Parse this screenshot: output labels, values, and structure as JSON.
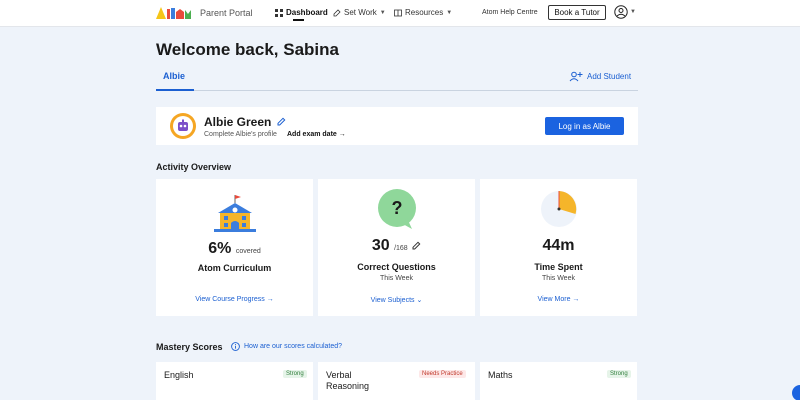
{
  "nav": {
    "portal_label": "Parent Portal",
    "dashboard": "Dashboard",
    "set_work": "Set Work",
    "resources": "Resources",
    "help": "Atom Help Centre",
    "book_tutor": "Book a Tutor"
  },
  "header": {
    "welcome": "Welcome back, Sabina",
    "tab": "Albie",
    "add_student": "Add Student"
  },
  "profile": {
    "name": "Albie Green",
    "complete": "Complete Albie's profile",
    "exam": "Add exam date →",
    "login": "Log in as Albie"
  },
  "activity": {
    "title": "Activity Overview",
    "curriculum": {
      "value": "6%",
      "unit": "covered",
      "label": "Atom Curriculum",
      "link": "View Course Progress →"
    },
    "questions": {
      "value": "30",
      "unit": "/168",
      "label": "Correct Questions",
      "sub": "This Week",
      "link": "View Subjects ⌄"
    },
    "time": {
      "value": "44m",
      "label": "Time Spent",
      "sub": "This Week",
      "link": "View More →"
    }
  },
  "mastery": {
    "title": "Mastery Scores",
    "question": "How are our scores calculated?",
    "subjects": [
      {
        "name": "English",
        "badge": "Strong"
      },
      {
        "name": "Verbal Reasoning",
        "badge": "Needs Practice"
      },
      {
        "name": "Maths",
        "badge": "Strong"
      }
    ]
  },
  "colors": {
    "accent": "#1b63e0",
    "background": "#eef3fa"
  }
}
